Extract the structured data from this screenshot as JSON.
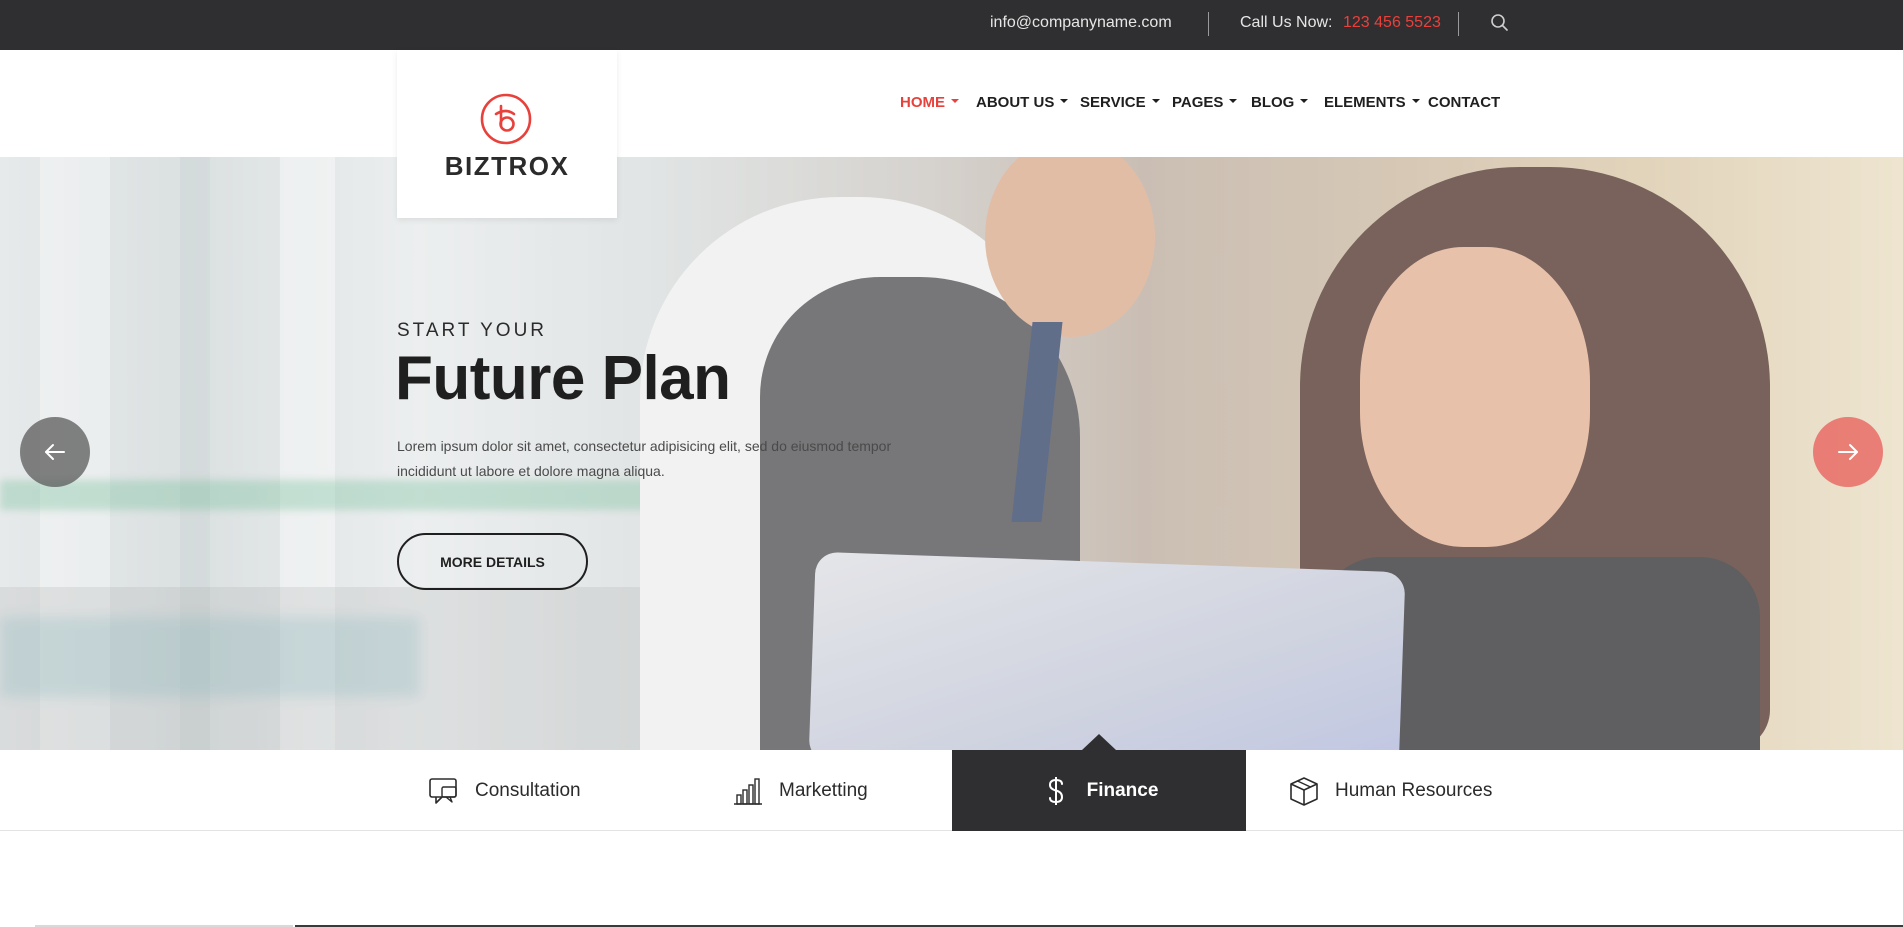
{
  "topbar": {
    "email": "info@companyname.com",
    "call_label": "Call Us Now:",
    "phone": "123 456 5523",
    "search_icon": "search-icon"
  },
  "brand": {
    "name": "BIZTROX",
    "logo_icon": "biztrox-logo-icon",
    "accent": "#e8413c"
  },
  "nav": {
    "items": [
      {
        "label": "HOME",
        "dropdown": true,
        "active": true
      },
      {
        "label": "ABOUT US",
        "dropdown": true
      },
      {
        "label": "SERVICE",
        "dropdown": true
      },
      {
        "label": "PAGES",
        "dropdown": true
      },
      {
        "label": "BLOG",
        "dropdown": true
      },
      {
        "label": "ELEMENTS",
        "dropdown": true
      },
      {
        "label": "CONTACT",
        "dropdown": false
      }
    ]
  },
  "hero": {
    "pre_title": "START YOUR",
    "title": "Future Plan",
    "description": "Lorem ipsum dolor sit amet, consectetur adipisicing elit, sed do eiusmod tempor incididunt ut labore et dolore magna aliqua.",
    "button_label": "MORE DETAILS",
    "prev_icon": "arrow-left-icon",
    "next_icon": "arrow-right-icon"
  },
  "tabs": [
    {
      "label": "Consultation",
      "icon": "chat-bubbles-icon"
    },
    {
      "label": "Marketting",
      "icon": "bar-chart-icon"
    },
    {
      "label": "Finance",
      "icon": "dollar-icon",
      "active": true
    },
    {
      "label": "Human Resources",
      "icon": "box-icon"
    }
  ],
  "colors": {
    "dark": "#2f2f31",
    "accent": "#e8413c"
  }
}
